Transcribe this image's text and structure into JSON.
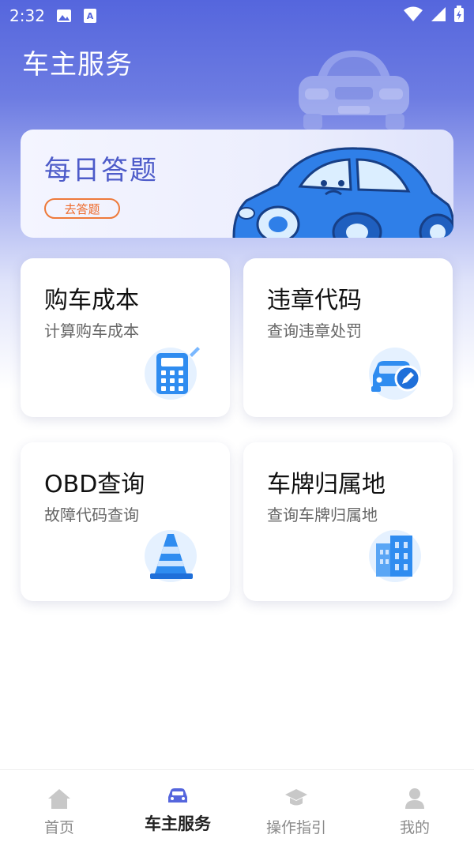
{
  "status_bar": {
    "time": "2:32"
  },
  "header": {
    "title": "车主服务"
  },
  "daily_quiz": {
    "title": "每日答题",
    "button": "去答题"
  },
  "tiles": [
    {
      "title": "购车成本",
      "subtitle": "计算购车成本",
      "icon": "calculator-icon"
    },
    {
      "title": "违章代码",
      "subtitle": "查询违章处罚",
      "icon": "car-edit-icon"
    },
    {
      "title": "OBD查询",
      "subtitle": "故障代码查询",
      "icon": "traffic-cone-icon"
    },
    {
      "title": "车牌归属地",
      "subtitle": "查询车牌归属地",
      "icon": "building-icon"
    }
  ],
  "tabbar": {
    "items": [
      {
        "label": "首页",
        "icon": "home-icon"
      },
      {
        "label": "车主服务",
        "icon": "car-icon",
        "active": true
      },
      {
        "label": "操作指引",
        "icon": "graduation-cap-icon"
      },
      {
        "label": "我的",
        "icon": "user-icon"
      }
    ]
  },
  "colors": {
    "primary": "#5566dd",
    "accent_orange": "#ee6a2a",
    "icon_blue": "#2f8cf0"
  }
}
